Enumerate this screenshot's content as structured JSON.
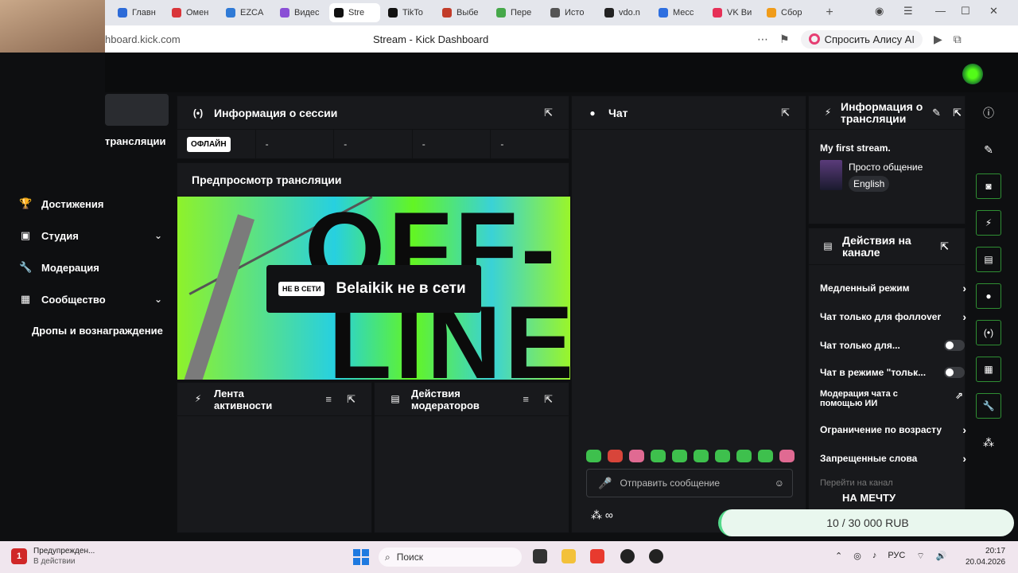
{
  "browser": {
    "tabs": [
      {
        "label": "Главн",
        "color": "#2d6bd8"
      },
      {
        "label": "Омен",
        "color": "#d9353a"
      },
      {
        "label": "EZCA",
        "color": "#2f7ad6"
      },
      {
        "label": "Видес",
        "color": "#8a4fd6"
      },
      {
        "label": "Stre",
        "color": "#111111"
      },
      {
        "label": "TikTo",
        "color": "#111111"
      },
      {
        "label": "Выбе",
        "color": "#c23c2a"
      },
      {
        "label": "Пере",
        "color": "#46a84a"
      },
      {
        "label": "Исто",
        "color": "#555555"
      },
      {
        "label": "vdo.n",
        "color": "#222222"
      },
      {
        "label": "Месс",
        "color": "#2e6fe0"
      },
      {
        "label": "VK Ви",
        "color": "#e63057"
      },
      {
        "label": "Сбор",
        "color": "#f09c1a"
      }
    ],
    "active_tab_index": 4,
    "url": "hboard.kick.com",
    "page_title": "Stream - Kick Dashboard",
    "alice_label": "Спросить Алису AI"
  },
  "sidebar": {
    "partial_label": "трансляции",
    "items": [
      {
        "label": "Достижения",
        "icon": "trophy-icon",
        "glyph": "🏆"
      },
      {
        "label": "Студия",
        "icon": "studio-icon",
        "glyph": "▣"
      },
      {
        "label": "Модерация",
        "icon": "wrench-icon",
        "glyph": "🔧"
      },
      {
        "label": "Сообщество",
        "icon": "community-icon",
        "glyph": "▦"
      },
      {
        "label": "Дропы и вознаграждение",
        "icon": "",
        "glyph": ""
      }
    ]
  },
  "session": {
    "title": "Информация о сессии",
    "status": "ОФЛАЙН",
    "stats": [
      "-",
      "-",
      "-",
      "-"
    ]
  },
  "preview": {
    "title": "Предпросмотр трансляции",
    "offline_badge": "НЕ В СЕТИ",
    "offline_text": "Belaikik не в сети",
    "art_line1": "OFF-",
    "art_line2": "LINE"
  },
  "activity": {
    "title": "Лента активности"
  },
  "mod_actions": {
    "title": "Действия модераторов"
  },
  "chat": {
    "title": "Чат",
    "input_placeholder": "Отправить сообщение",
    "footer": "∞"
  },
  "stream_info": {
    "title": "Информация о трансляции",
    "stream_title": "My first stream.",
    "category": "Просто общение",
    "language": "English"
  },
  "channel_actions": {
    "title": "Действия на канале",
    "items": [
      {
        "label": "Медленный режим",
        "control": "arrow"
      },
      {
        "label": "Чат только для фоллover",
        "control": "arrow"
      },
      {
        "label": "Чат только для...",
        "control": "toggle"
      },
      {
        "label": "Чат в режиме \"тольк...",
        "control": "toggle"
      },
      {
        "label": "Модерация чата с помощью ИИ",
        "control": "external"
      },
      {
        "label": "Ограничение по возрасту",
        "control": "arrow"
      },
      {
        "label": "Запрещенные слова",
        "control": "arrow"
      },
      {
        "label": "Перейти на канал",
        "control": "none"
      }
    ]
  },
  "goal": {
    "label": "НА МЕЧТУ",
    "text": "10 / 30 000 RUB"
  },
  "taskbar": {
    "warning_title": "Предупрежден...",
    "warning_sub": "В действии",
    "warning_count": "1",
    "search": "Поиск",
    "lang": "РУС",
    "time": "20:17",
    "date": "20.04.2026"
  },
  "colors": {
    "accent": "#53fc18",
    "panel": "#18191c",
    "bg": "#0e0f11"
  }
}
